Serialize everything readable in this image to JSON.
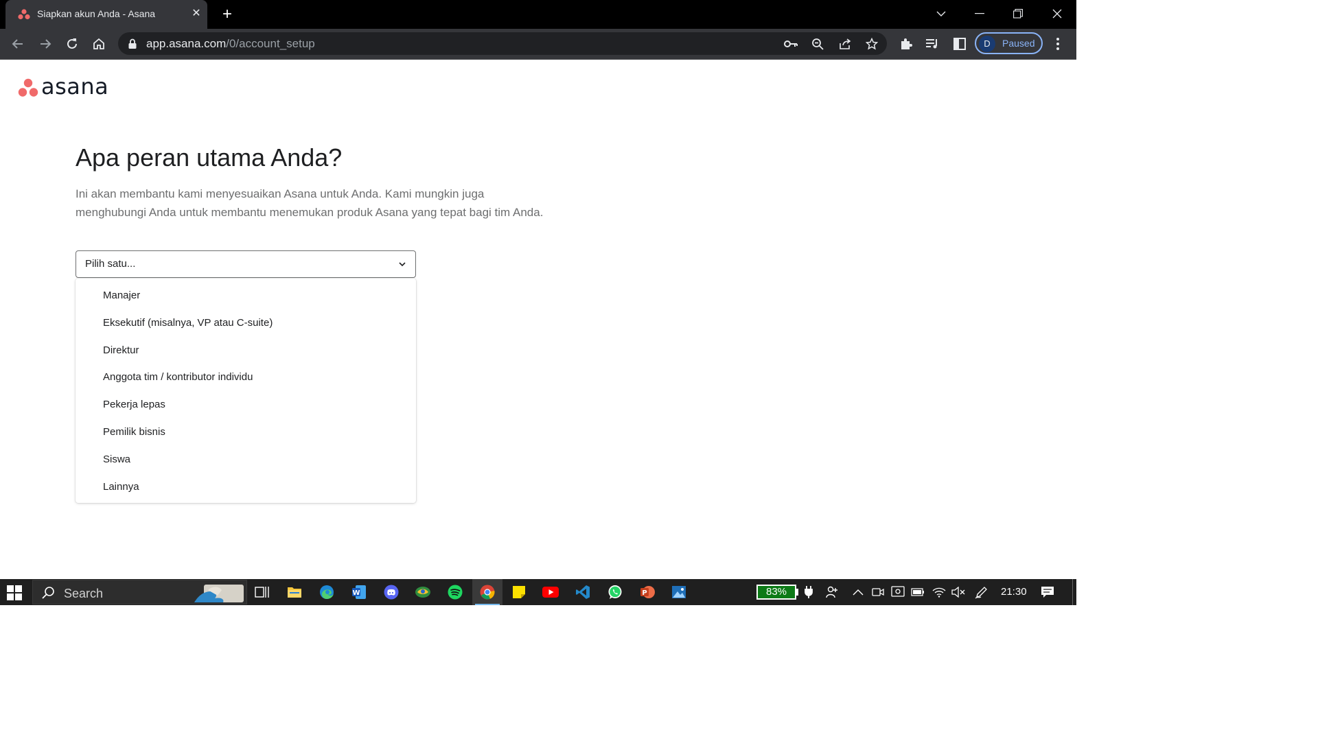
{
  "browser": {
    "tab": {
      "title": "Siapkan akun Anda - Asana",
      "favicon": "asana-logo-icon"
    },
    "url": {
      "host": "app.asana.com",
      "path": "/0/account_setup"
    },
    "profile": {
      "initial": "D",
      "status": "Paused"
    },
    "icons": [
      "back-icon",
      "forward-icon",
      "reload-icon",
      "home-icon",
      "lock-icon",
      "key-icon",
      "zoom-icon",
      "share-icon",
      "star-icon",
      "extensions-icon",
      "media-icon",
      "side-panel-icon",
      "menu-icon"
    ]
  },
  "page": {
    "logo_text": "asana",
    "heading": "Apa peran utama Anda?",
    "subtitle_line1": "Ini akan membantu kami menyesuaikan Asana untuk Anda. Kami mungkin juga",
    "subtitle_line2": "menghubungi Anda untuk membantu menemukan produk Asana yang tepat bagi tim Anda.",
    "select": {
      "placeholder": "Pilih satu..."
    },
    "options": [
      "Manajer",
      "Eksekutif (misalnya, VP atau C-suite)",
      "Direktur",
      "Anggota tim / kontributor individu",
      "Pekerja lepas",
      "Pemilik bisnis",
      "Siswa",
      "Lainnya"
    ]
  },
  "colors": {
    "asana_coral": "#f06a6a",
    "profile_accent": "#8ab4f8",
    "battery_green": "#0d7a17"
  },
  "taskbar": {
    "search_label": "Search",
    "apps": [
      "task-view-icon",
      "file-explorer-icon",
      "edge-icon",
      "word-icon",
      "discord-icon",
      "maps-icon",
      "spotify-icon",
      "chrome-icon",
      "sticky-notes-icon",
      "youtube-icon",
      "vscode-icon",
      "whatsapp-icon",
      "powerpoint-icon",
      "photos-icon"
    ],
    "battery": "83%",
    "time": "21:30"
  }
}
